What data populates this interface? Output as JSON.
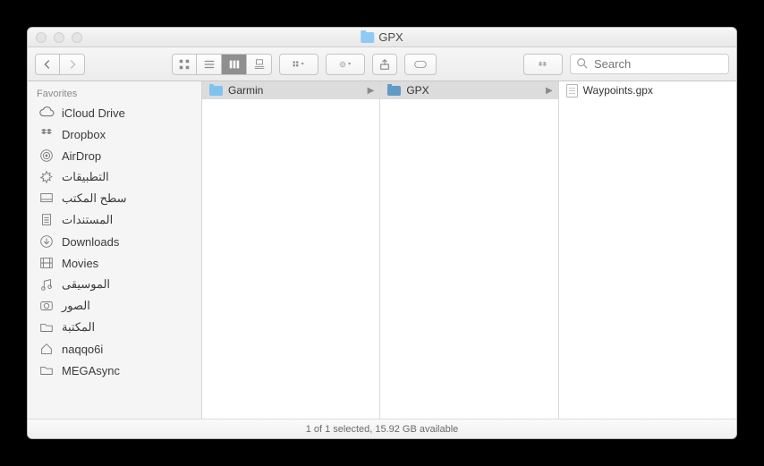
{
  "window": {
    "title": "GPX"
  },
  "toolbar": {
    "search_placeholder": "Search"
  },
  "sidebar": {
    "header": "Favorites",
    "items": [
      {
        "label": "iCloud Drive"
      },
      {
        "label": "Dropbox"
      },
      {
        "label": "AirDrop"
      },
      {
        "label": "التطبيقات"
      },
      {
        "label": "سطح المكتب"
      },
      {
        "label": "المستندات"
      },
      {
        "label": "Downloads"
      },
      {
        "label": "Movies"
      },
      {
        "label": "الموسيقى"
      },
      {
        "label": "الصور"
      },
      {
        "label": "المكتبة"
      },
      {
        "label": "naqqo6i"
      },
      {
        "label": "MEGAsync"
      }
    ]
  },
  "columns": [
    {
      "name": "Garmin",
      "selected": true,
      "is_folder": true
    },
    {
      "name": "GPX",
      "selected": true,
      "is_folder": true
    },
    {
      "name": "Waypoints.gpx",
      "selected": false,
      "is_folder": false
    }
  ],
  "status": "1 of 1 selected, 15.92 GB available"
}
